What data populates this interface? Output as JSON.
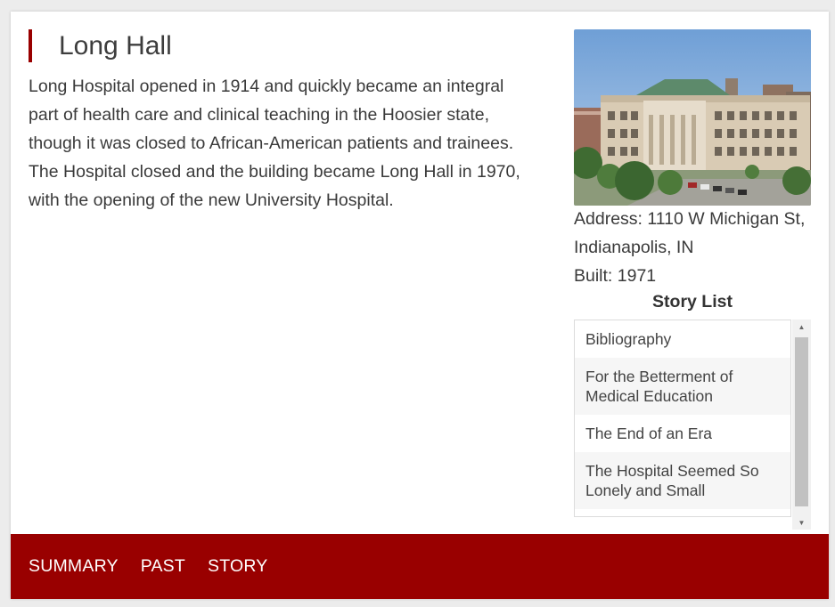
{
  "page": {
    "title": "Long Hall",
    "description": "Long Hospital opened in 1914 and quickly became an integral part of health care and clinical teaching in the Hoosier state, though it was closed to African-American patients and trainees. The Hospital closed and the building became Long Hall in 1970, with the opening of the new University Hospital."
  },
  "info": {
    "address": "Address: 1110 W Michigan St, Indianapolis, IN",
    "built": "Built: 1971"
  },
  "story_list": {
    "heading": "Story List",
    "items": [
      "Bibliography",
      "For the Betterment of Medical Education",
      "The End of an Era",
      "The Hospital Seemed So Lonely and Small"
    ]
  },
  "nav": {
    "items": [
      "SUMMARY",
      "PAST",
      "STORY"
    ]
  },
  "colors": {
    "accent": "#990000",
    "text": "#3a3a3a"
  }
}
